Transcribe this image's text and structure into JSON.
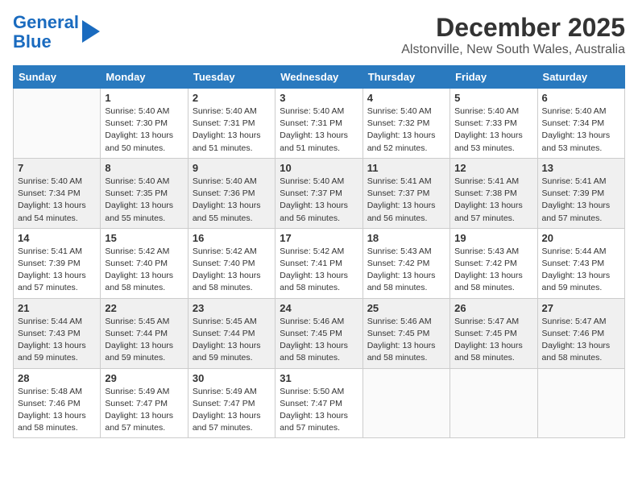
{
  "header": {
    "logo_line1": "General",
    "logo_line2": "Blue",
    "title": "December 2025",
    "subtitle": "Alstonville, New South Wales, Australia"
  },
  "calendar": {
    "days_of_week": [
      "Sunday",
      "Monday",
      "Tuesday",
      "Wednesday",
      "Thursday",
      "Friday",
      "Saturday"
    ],
    "weeks": [
      [
        {
          "day": "",
          "info": ""
        },
        {
          "day": "1",
          "info": "Sunrise: 5:40 AM\nSunset: 7:30 PM\nDaylight: 13 hours\nand 50 minutes."
        },
        {
          "day": "2",
          "info": "Sunrise: 5:40 AM\nSunset: 7:31 PM\nDaylight: 13 hours\nand 51 minutes."
        },
        {
          "day": "3",
          "info": "Sunrise: 5:40 AM\nSunset: 7:31 PM\nDaylight: 13 hours\nand 51 minutes."
        },
        {
          "day": "4",
          "info": "Sunrise: 5:40 AM\nSunset: 7:32 PM\nDaylight: 13 hours\nand 52 minutes."
        },
        {
          "day": "5",
          "info": "Sunrise: 5:40 AM\nSunset: 7:33 PM\nDaylight: 13 hours\nand 53 minutes."
        },
        {
          "day": "6",
          "info": "Sunrise: 5:40 AM\nSunset: 7:34 PM\nDaylight: 13 hours\nand 53 minutes."
        }
      ],
      [
        {
          "day": "7",
          "info": "Sunrise: 5:40 AM\nSunset: 7:34 PM\nDaylight: 13 hours\nand 54 minutes."
        },
        {
          "day": "8",
          "info": "Sunrise: 5:40 AM\nSunset: 7:35 PM\nDaylight: 13 hours\nand 55 minutes."
        },
        {
          "day": "9",
          "info": "Sunrise: 5:40 AM\nSunset: 7:36 PM\nDaylight: 13 hours\nand 55 minutes."
        },
        {
          "day": "10",
          "info": "Sunrise: 5:40 AM\nSunset: 7:37 PM\nDaylight: 13 hours\nand 56 minutes."
        },
        {
          "day": "11",
          "info": "Sunrise: 5:41 AM\nSunset: 7:37 PM\nDaylight: 13 hours\nand 56 minutes."
        },
        {
          "day": "12",
          "info": "Sunrise: 5:41 AM\nSunset: 7:38 PM\nDaylight: 13 hours\nand 57 minutes."
        },
        {
          "day": "13",
          "info": "Sunrise: 5:41 AM\nSunset: 7:39 PM\nDaylight: 13 hours\nand 57 minutes."
        }
      ],
      [
        {
          "day": "14",
          "info": "Sunrise: 5:41 AM\nSunset: 7:39 PM\nDaylight: 13 hours\nand 57 minutes."
        },
        {
          "day": "15",
          "info": "Sunrise: 5:42 AM\nSunset: 7:40 PM\nDaylight: 13 hours\nand 58 minutes."
        },
        {
          "day": "16",
          "info": "Sunrise: 5:42 AM\nSunset: 7:40 PM\nDaylight: 13 hours\nand 58 minutes."
        },
        {
          "day": "17",
          "info": "Sunrise: 5:42 AM\nSunset: 7:41 PM\nDaylight: 13 hours\nand 58 minutes."
        },
        {
          "day": "18",
          "info": "Sunrise: 5:43 AM\nSunset: 7:42 PM\nDaylight: 13 hours\nand 58 minutes."
        },
        {
          "day": "19",
          "info": "Sunrise: 5:43 AM\nSunset: 7:42 PM\nDaylight: 13 hours\nand 58 minutes."
        },
        {
          "day": "20",
          "info": "Sunrise: 5:44 AM\nSunset: 7:43 PM\nDaylight: 13 hours\nand 59 minutes."
        }
      ],
      [
        {
          "day": "21",
          "info": "Sunrise: 5:44 AM\nSunset: 7:43 PM\nDaylight: 13 hours\nand 59 minutes."
        },
        {
          "day": "22",
          "info": "Sunrise: 5:45 AM\nSunset: 7:44 PM\nDaylight: 13 hours\nand 59 minutes."
        },
        {
          "day": "23",
          "info": "Sunrise: 5:45 AM\nSunset: 7:44 PM\nDaylight: 13 hours\nand 59 minutes."
        },
        {
          "day": "24",
          "info": "Sunrise: 5:46 AM\nSunset: 7:45 PM\nDaylight: 13 hours\nand 58 minutes."
        },
        {
          "day": "25",
          "info": "Sunrise: 5:46 AM\nSunset: 7:45 PM\nDaylight: 13 hours\nand 58 minutes."
        },
        {
          "day": "26",
          "info": "Sunrise: 5:47 AM\nSunset: 7:45 PM\nDaylight: 13 hours\nand 58 minutes."
        },
        {
          "day": "27",
          "info": "Sunrise: 5:47 AM\nSunset: 7:46 PM\nDaylight: 13 hours\nand 58 minutes."
        }
      ],
      [
        {
          "day": "28",
          "info": "Sunrise: 5:48 AM\nSunset: 7:46 PM\nDaylight: 13 hours\nand 58 minutes."
        },
        {
          "day": "29",
          "info": "Sunrise: 5:49 AM\nSunset: 7:47 PM\nDaylight: 13 hours\nand 57 minutes."
        },
        {
          "day": "30",
          "info": "Sunrise: 5:49 AM\nSunset: 7:47 PM\nDaylight: 13 hours\nand 57 minutes."
        },
        {
          "day": "31",
          "info": "Sunrise: 5:50 AM\nSunset: 7:47 PM\nDaylight: 13 hours\nand 57 minutes."
        },
        {
          "day": "",
          "info": ""
        },
        {
          "day": "",
          "info": ""
        },
        {
          "day": "",
          "info": ""
        }
      ]
    ]
  }
}
